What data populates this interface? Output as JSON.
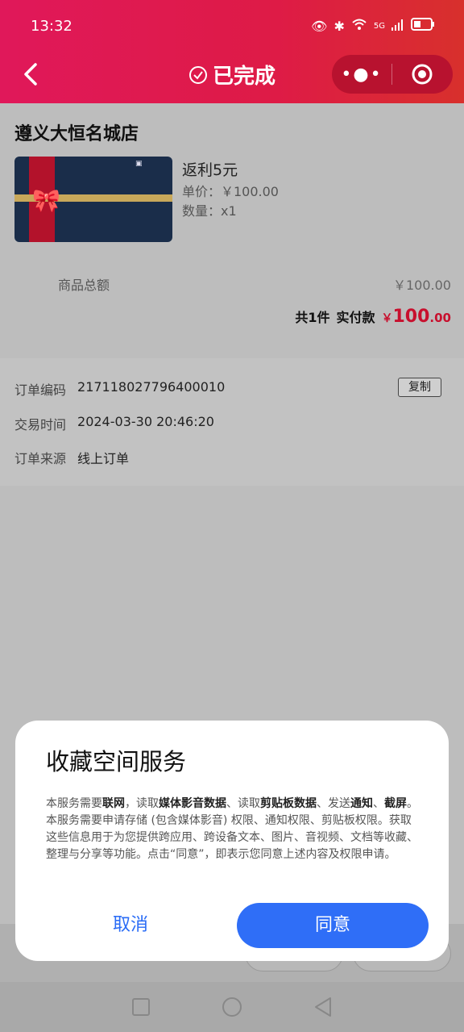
{
  "status": {
    "time": "13:32",
    "network": "5G"
  },
  "header": {
    "title": "已完成",
    "more_label": "•●•"
  },
  "store": {
    "name": "遵义大恒名城店",
    "product": {
      "name": "返利5元",
      "price": "单价：￥100.00",
      "quantity": "数量：x1"
    },
    "total_label": "商品总额",
    "total_value": "￥100.00",
    "count": "共1件",
    "paid_label": "实付款",
    "paid_symbol": "￥",
    "paid_int": "100",
    "paid_dec": ".00"
  },
  "order": {
    "code_label": "订单编码",
    "code_value": "217118027796400010",
    "copy_label": "复制",
    "time_label": "交易时间",
    "time_value": "2024-03-30 20:46:20",
    "source_label": "订单来源",
    "source_value": "线上订单"
  },
  "dialog": {
    "title": "收藏空间服务",
    "body_1": "本服务需要",
    "body_b1": "联网",
    "body_2": "，读取",
    "body_b2": "媒体影音数据",
    "body_3": "、读取",
    "body_b3": "剪贴板数据",
    "body_4": "、发送",
    "body_b4": "通知",
    "body_5": "、",
    "body_b5": "截屏",
    "body_6": "。本服务需要申请存储 (包含媒体影音) 权限、通知权限、剪贴板权限。获取这些信息用于为您提供跨应用、跨设备文本、图片、音视频、文档等收藏、整理与分享等功能。点击“同意”，即表示您同意上述内容及权限申请。",
    "cancel_label": "取消",
    "agree_label": "同意"
  },
  "colors": {
    "header": "#e0185a",
    "accent_red": "#c8102e",
    "primary_blue": "#2f6ef7"
  }
}
